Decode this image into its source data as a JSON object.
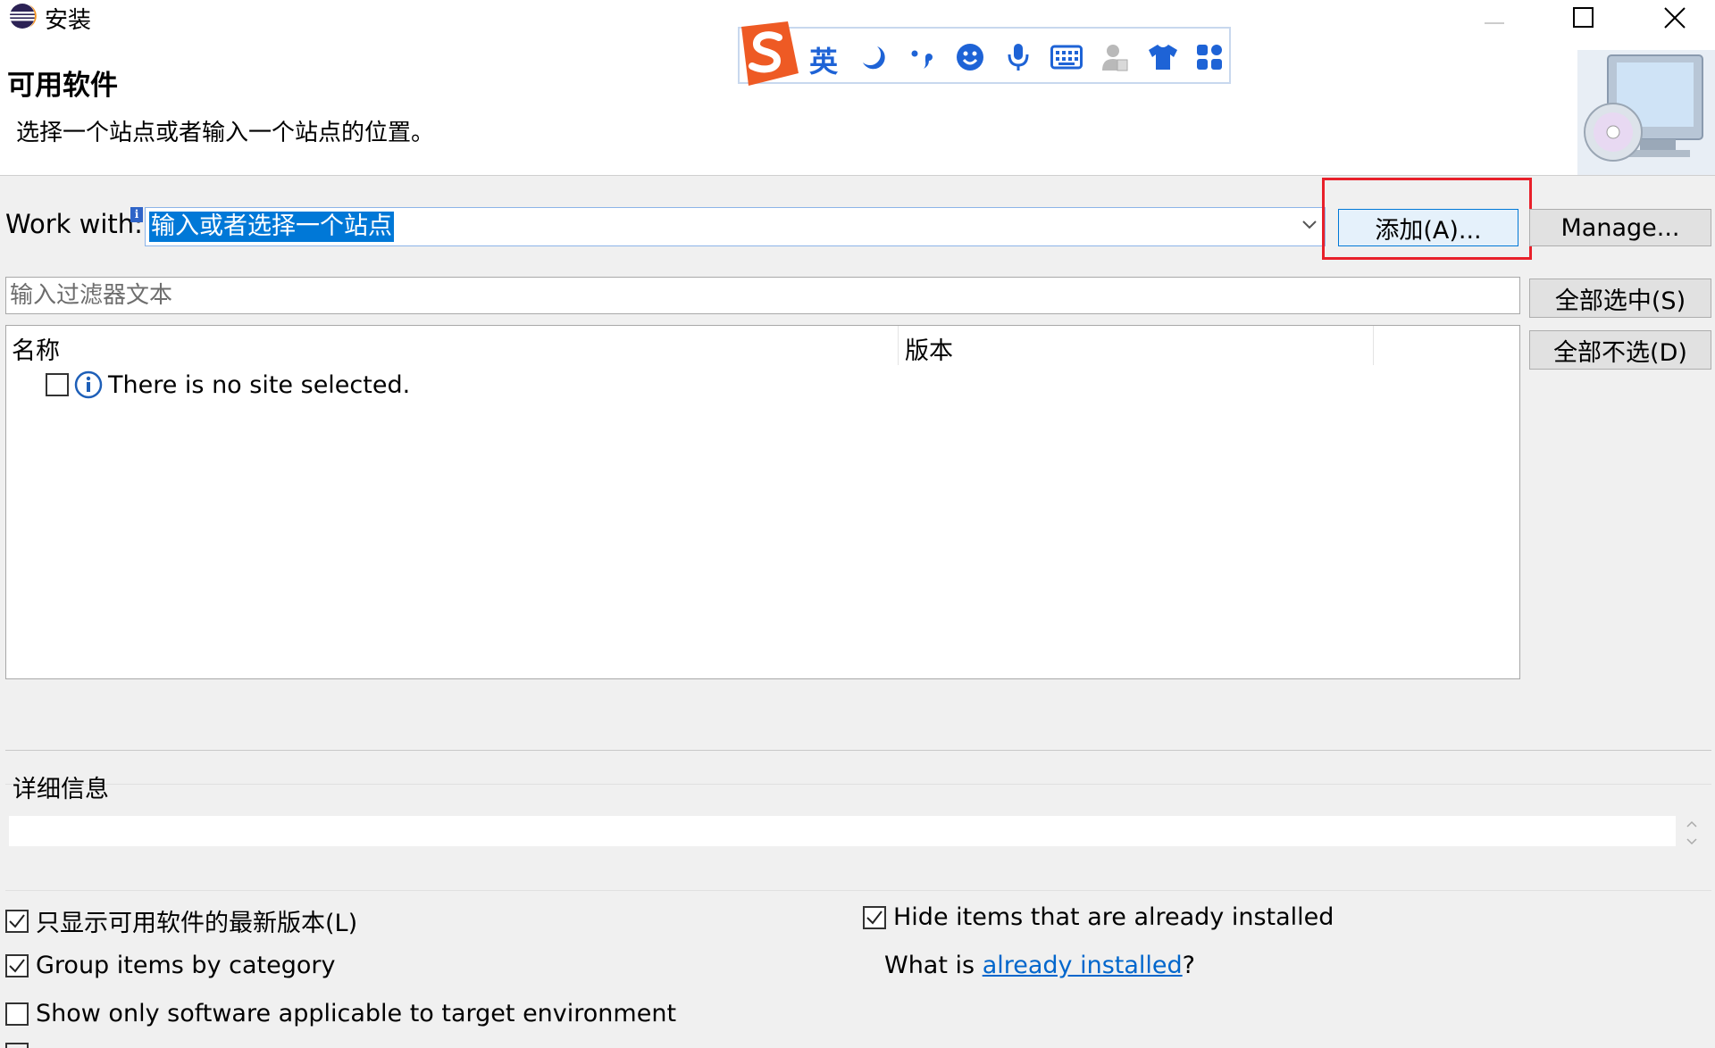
{
  "window": {
    "title": "安装",
    "controls": {
      "minimize": "minimize",
      "maximize": "maximize",
      "close": "close"
    }
  },
  "header": {
    "title": "可用软件",
    "description": "选择一个站点或者输入一个站点的位置。"
  },
  "ime_toolbar": {
    "language": "英",
    "icons": [
      "sogou-logo-icon",
      "moon-icon",
      "punctuation-icon",
      "smiley-icon",
      "microphone-icon",
      "keyboard-icon",
      "user-icon",
      "tshirt-icon",
      "grid-icon"
    ],
    "accent_color": "#1e63d6"
  },
  "work_with": {
    "label": "Work with:",
    "value": "输入或者选择一个站点",
    "add_button": "添加(A)...",
    "manage_button": "Manage..."
  },
  "filter": {
    "placeholder": "输入过滤器文本"
  },
  "buttons": {
    "select_all": "全部选中(S)",
    "deselect_all": "全部不选(D)"
  },
  "table": {
    "columns": [
      "名称",
      "版本"
    ],
    "rows": [
      {
        "checked": false,
        "icon": "info-icon",
        "name": "There is no site selected."
      }
    ]
  },
  "details": {
    "label": "详细信息",
    "content": ""
  },
  "options": {
    "show_latest": {
      "label": "只显示可用软件的最新版本(L)",
      "checked": true
    },
    "group_by_category": {
      "label": "Group items by category",
      "checked": true
    },
    "applicable_only": {
      "label": "Show only software applicable to target environment",
      "checked": false
    },
    "hide_installed": {
      "label": "Hide items that are already installed",
      "checked": true
    },
    "what_is_prefix": "What is ",
    "what_is_link": "already installed",
    "what_is_suffix": "?"
  },
  "colors": {
    "highlight_box": "#e8202a",
    "selection": "#0078d7",
    "link": "#0066cc"
  }
}
